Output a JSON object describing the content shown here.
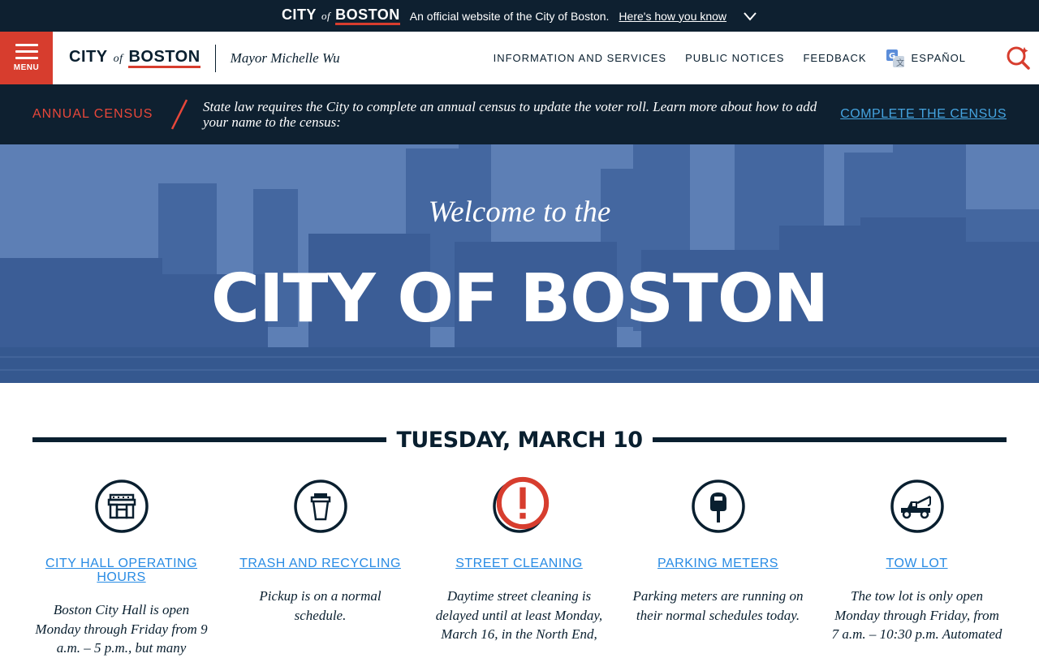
{
  "official_bar": {
    "logo_city": "CITY",
    "logo_of": "of",
    "logo_boston": "BOSTON",
    "text": "An official website of the City of Boston.",
    "link": "Here's how you know"
  },
  "header": {
    "menu_label": "MENU",
    "logo_city": "CITY",
    "logo_of": "of",
    "logo_boston": "BOSTON",
    "mayor": "Mayor Michelle Wu",
    "nav": [
      {
        "label": "INFORMATION AND SERVICES"
      },
      {
        "label": "PUBLIC NOTICES"
      },
      {
        "label": "FEEDBACK"
      },
      {
        "label": "ESPAÑOL"
      }
    ]
  },
  "alert": {
    "title": "ANNUAL CENSUS",
    "text": "State law requires the City to complete an annual census to update the voter roll. Learn more about how to add your name to the census:",
    "link": "COMPLETE THE CENSUS"
  },
  "hero": {
    "welcome": "Welcome to the",
    "title": "CITY OF BOSTON"
  },
  "date_heading": "TUESDAY, MARCH 10",
  "services": [
    {
      "icon": "city-hall-icon",
      "title": "CITY HALL OPERATING HOURS",
      "text": "Boston City Hall is open Monday through Friday from 9 a.m. – 5 p.m., but many"
    },
    {
      "icon": "trash-can-icon",
      "title": "TRASH AND RECYCLING",
      "text": "Pickup is on a normal schedule."
    },
    {
      "icon": "street-sweeper-icon",
      "title": "STREET CLEANING",
      "text": "Daytime street cleaning is delayed until at least Monday, March 16, in the North End,",
      "alert": true
    },
    {
      "icon": "parking-meter-icon",
      "title": "PARKING METERS",
      "text": "Parking meters are running on their normal schedules today."
    },
    {
      "icon": "tow-truck-icon",
      "title": "TOW LOT",
      "text": "The tow lot is only open Monday through Friday, from 7 a.m. – 10:30 p.m. Automated"
    }
  ],
  "colors": {
    "navy": "#091f2f",
    "red": "#d73d2e",
    "link_blue": "#288be4",
    "alert_link": "#45a4e0"
  }
}
